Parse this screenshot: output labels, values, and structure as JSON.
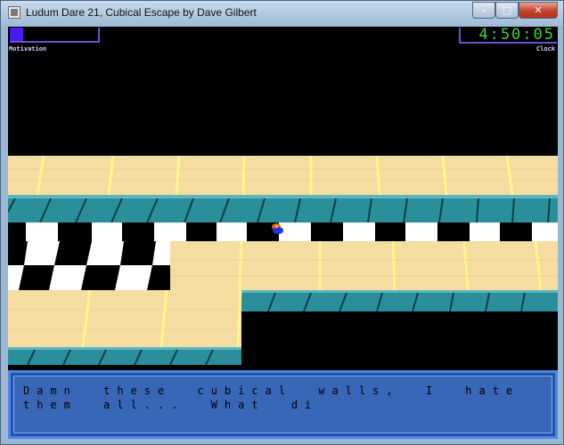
{
  "window": {
    "title": "Ludum Dare 21, Cubical Escape by Dave Gilbert",
    "controls": {
      "minimize": "–",
      "maximize": "□",
      "close": "✕"
    }
  },
  "hud": {
    "motivation_label": "Motivation",
    "motivation_level": 0.15,
    "clock_label": "Clock",
    "clock_time": "4:50:05"
  },
  "dialog": {
    "text": "Damn these cubical walls, I hate them all... What di"
  },
  "scene": {
    "colors": {
      "floor": "#f5dca0",
      "wall": "#2a8f9a",
      "checker_dark": "#000000",
      "checker_light": "#ffffff",
      "background": "#000000"
    }
  }
}
